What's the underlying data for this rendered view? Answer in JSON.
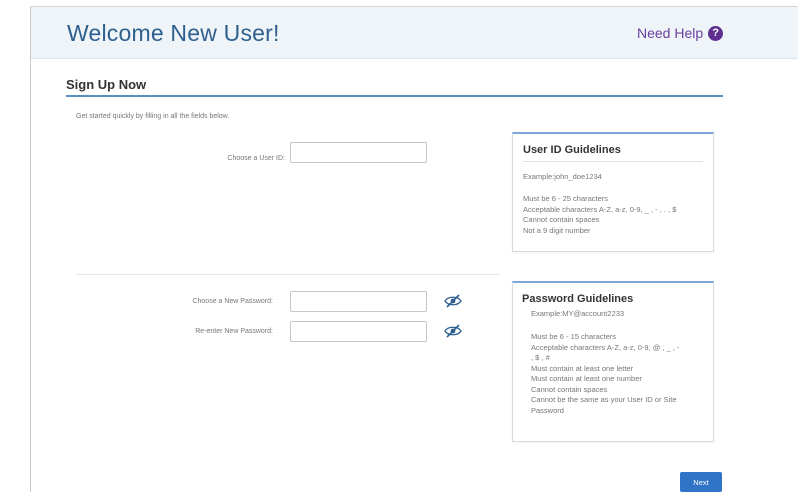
{
  "header": {
    "title": "Welcome New User!",
    "help_label": "Need Help",
    "help_icon": "?"
  },
  "section": {
    "title": "Sign Up Now",
    "intro": "Get started quickly by filling in all the fields below."
  },
  "form": {
    "user_id_label": "Choose a User ID:",
    "user_id_value": "",
    "new_password_label": "Choose a New Password:",
    "new_password_value": "",
    "reenter_password_label": "Re-enter New Password:",
    "reenter_password_value": ""
  },
  "user_id_guidelines": {
    "title": "User ID Guidelines",
    "example": "Example:john_doe1234",
    "rules": [
      "Must be 6 - 25 characters",
      "Acceptable characters A-Z, a-z, 0-9, _ , - , . , $",
      "Cannot contain spaces",
      "Not a 9 digit number"
    ]
  },
  "password_guidelines": {
    "title": "Password Guidelines",
    "example": "Example:MY@account2233",
    "rules": [
      "Must be 6 - 15 characters",
      "Acceptable characters A-Z, a-z, 0-9, @ , _ , -",
      ", $ , #",
      "Must contain at least one letter",
      "Must contain at least one number",
      "Cannot contain spaces",
      "Cannot be the same as your User ID or Site",
      "Password"
    ]
  },
  "actions": {
    "next_label": "Next"
  },
  "colors": {
    "title_blue": "#2f5f8f",
    "help_purple": "#6b3fa0",
    "accent_blue": "#5b8fc7",
    "button_blue": "#2f74c6"
  },
  "icons": {
    "help": "question-circle-icon",
    "password_toggle": "eye-slash-icon"
  }
}
